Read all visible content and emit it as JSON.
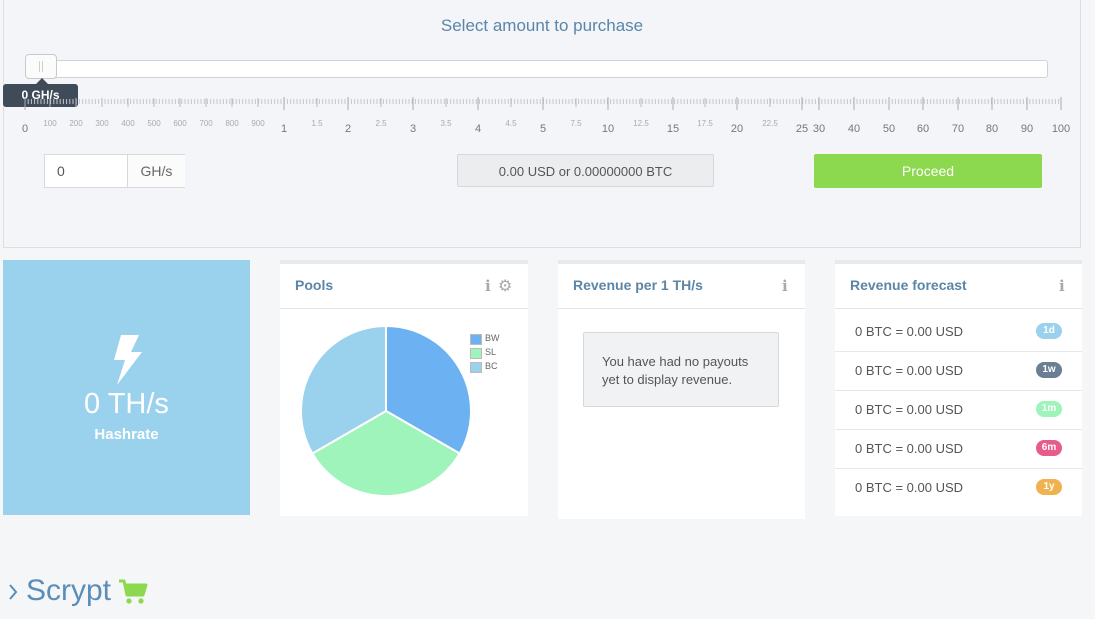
{
  "purchase": {
    "title": "Select amount to purchase",
    "slider_value_label": "0 GH/s",
    "slider_fraction": 0,
    "scale_major_labels": [
      "0",
      "1",
      "2",
      "3",
      "4",
      "5",
      "10",
      "15",
      "20",
      "25",
      "30",
      "40",
      "50",
      "60",
      "70",
      "80",
      "90",
      "100"
    ],
    "scale_minor_labels": [
      "100",
      "200",
      "300",
      "400",
      "500",
      "600",
      "700",
      "800",
      "900",
      "1.5",
      "2.5",
      "3.5",
      "4.5",
      "7.5",
      "12.5",
      "17.5",
      "22.5"
    ],
    "amount_input_value": "0",
    "amount_unit": "GH/s",
    "price_text": "0.00 USD or 0.00000000 BTC",
    "proceed_label": "Proceed"
  },
  "hashrate": {
    "value": "0 TH/s",
    "label": "Hashrate",
    "icon": "bolt-icon"
  },
  "pools": {
    "title": "Pools",
    "info_icon": "i",
    "legend": [
      {
        "label": "BW",
        "color": "#6cb2f2",
        "fraction": 0.3333
      },
      {
        "label": "SL",
        "color": "#9ef4bb",
        "fraction": 0.3333
      },
      {
        "label": "BC",
        "color": "#9ad1ed",
        "fraction": 0.3334
      }
    ]
  },
  "revenue": {
    "title": "Revenue per 1 TH/s",
    "info_icon": "i",
    "message_line1": "You have had no payouts",
    "message_line2": "yet to display revenue."
  },
  "forecast": {
    "title": "Revenue forecast",
    "info_icon": "i",
    "rows": [
      {
        "text": "0 BTC = 0.00 USD",
        "badge": "1d",
        "color": "#9ad1ed"
      },
      {
        "text": "0 BTC = 0.00 USD",
        "badge": "1w",
        "color": "#6a7f94"
      },
      {
        "text": "0 BTC = 0.00 USD",
        "badge": "1m",
        "color": "#9ef4bb"
      },
      {
        "text": "0 BTC = 0.00 USD",
        "badge": "6m",
        "color": "#e85c8d"
      },
      {
        "text": "0 BTC = 0.00 USD",
        "badge": "1y",
        "color": "#f0b250"
      }
    ]
  },
  "section": {
    "title": "Scrypt"
  },
  "colors": {
    "accent": "#5a86a8",
    "proceed": "#8cd94f",
    "hashrate_bg": "#9ad1ed"
  }
}
